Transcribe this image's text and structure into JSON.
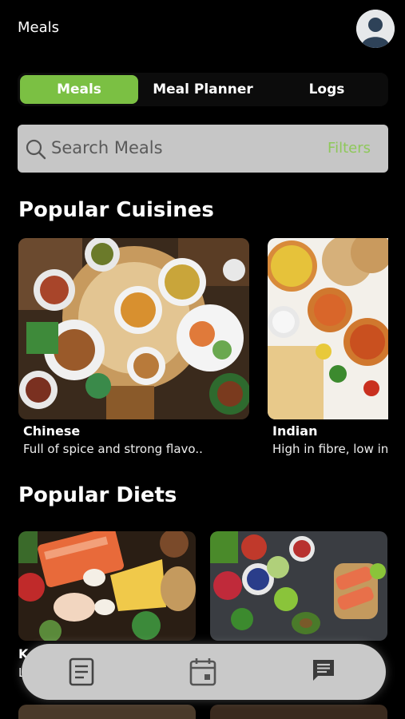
{
  "header": {
    "title": "Meals"
  },
  "tabs": [
    {
      "label": "Meals",
      "active": true
    },
    {
      "label": "Meal Planner",
      "active": false
    },
    {
      "label": "Logs",
      "active": false
    }
  ],
  "search": {
    "placeholder": "Search Meals",
    "filters_label": "Filters"
  },
  "sections": {
    "cuisines_title": "Popular Cuisines",
    "diets_title": "Popular Diets"
  },
  "cuisines": [
    {
      "name": "Chinese",
      "description": "Full of spice and strong flavo.."
    },
    {
      "name": "Indian",
      "description": "High in fibre, low in"
    }
  ],
  "diets": [
    {
      "name": "K",
      "description": "L"
    }
  ],
  "bottom_nav": [
    {
      "icon": "document-icon"
    },
    {
      "icon": "calendar-icon"
    },
    {
      "icon": "chat-icon"
    }
  ],
  "colors": {
    "accent": "#7bc043",
    "background": "#000000",
    "search_bg": "#c6c6c6",
    "nav_bg": "#c9c9c9"
  }
}
